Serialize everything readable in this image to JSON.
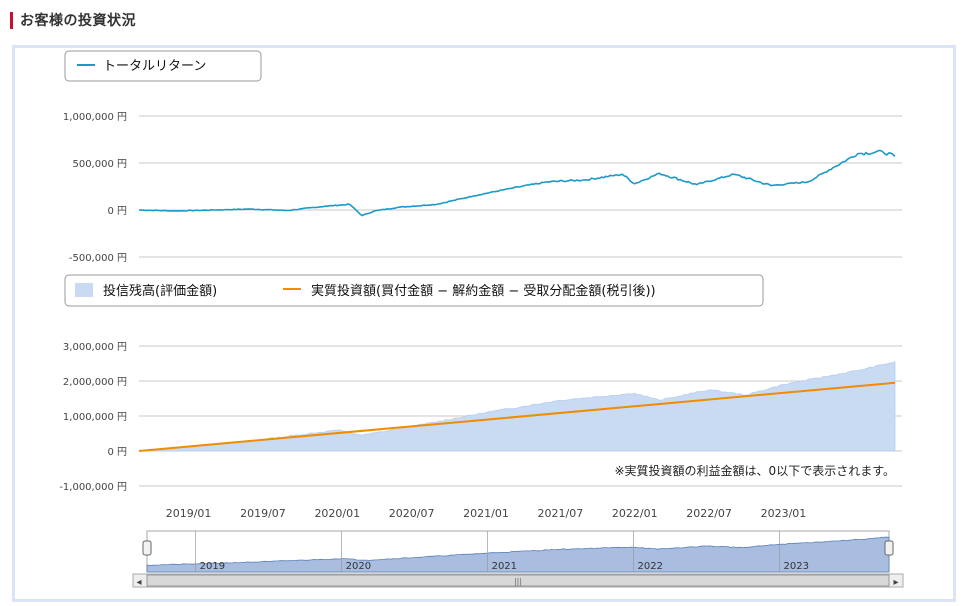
{
  "heading": "お客様の投資状況",
  "colors": {
    "accent": "#c8102e",
    "return_line": "#1a9ac8",
    "asset_fill": "#c9daf3",
    "invest_line": "#f08c00",
    "navigator_fill": "#a8bde0",
    "panel_border": "#dbe4f5"
  },
  "chart_data": [
    {
      "type": "line",
      "yunit": "円",
      "ylim": [
        -500000,
        1000000
      ],
      "yticks": [
        "1,000,000 円",
        "500,000 円",
        "0 円",
        "-500,000 円"
      ],
      "yticks_values": [
        1000000,
        500000,
        0,
        -500000
      ],
      "xlim": [
        "2018/09",
        "2023/10"
      ],
      "grid": true,
      "legend_position": "top-left",
      "series": [
        {
          "name": "トータルリターン",
          "x": [
            "2018/09",
            "2018/12",
            "2019/03",
            "2019/06",
            "2019/09",
            "2019/12",
            "2020/02",
            "2020/03",
            "2020/04",
            "2020/06",
            "2020/09",
            "2020/12",
            "2021/03",
            "2021/06",
            "2021/09",
            "2021/12",
            "2022/01",
            "2022/03",
            "2022/06",
            "2022/09",
            "2022/12",
            "2023/03",
            "2023/05",
            "2023/07",
            "2023/09",
            "2023/10"
          ],
          "values": [
            0,
            -10000,
            0,
            10000,
            -5000,
            40000,
            60000,
            -60000,
            -10000,
            30000,
            60000,
            150000,
            230000,
            300000,
            320000,
            380000,
            280000,
            390000,
            270000,
            380000,
            260000,
            300000,
            450000,
            600000,
            620000,
            570000
          ]
        }
      ]
    },
    {
      "type": "area",
      "yunit": "円",
      "ylim": [
        -1000000,
        3000000
      ],
      "yticks": [
        "3,000,000 円",
        "2,000,000 円",
        "1,000,000 円",
        "0 円",
        "-1,000,000 円"
      ],
      "yticks_values": [
        3000000,
        2000000,
        1000000,
        0,
        -1000000
      ],
      "xlim": [
        "2018/09",
        "2023/10"
      ],
      "xticks": [
        "2019/01",
        "2019/07",
        "2020/01",
        "2020/07",
        "2021/01",
        "2021/07",
        "2022/01",
        "2022/07",
        "2023/01"
      ],
      "grid": true,
      "legend_position": "top-left",
      "annotation": "※実質投資額の利益金額は、0以下で表示されます。",
      "series": [
        {
          "name": "投信残高(評価金額)",
          "kind": "area",
          "x": [
            "2018/09",
            "2019/01",
            "2019/07",
            "2020/01",
            "2020/03",
            "2020/07",
            "2021/01",
            "2021/07",
            "2022/01",
            "2022/03",
            "2022/07",
            "2022/10",
            "2023/01",
            "2023/07",
            "2023/10"
          ],
          "values": [
            0,
            110000,
            330000,
            600000,
            450000,
            700000,
            1100000,
            1450000,
            1650000,
            1450000,
            1750000,
            1600000,
            1900000,
            2300000,
            2550000
          ]
        },
        {
          "name": "実質投資額(買付金額 − 解約金額 − 受取分配金額(税引後))",
          "kind": "line",
          "x": [
            "2018/09",
            "2023/10"
          ],
          "values": [
            0,
            1950000
          ]
        }
      ]
    }
  ],
  "navigator": {
    "labels": [
      "2019",
      "2020",
      "2021",
      "2022",
      "2023"
    ],
    "scroll_left": "◂",
    "scroll_right": "▸",
    "scroll_grip": "|||"
  }
}
